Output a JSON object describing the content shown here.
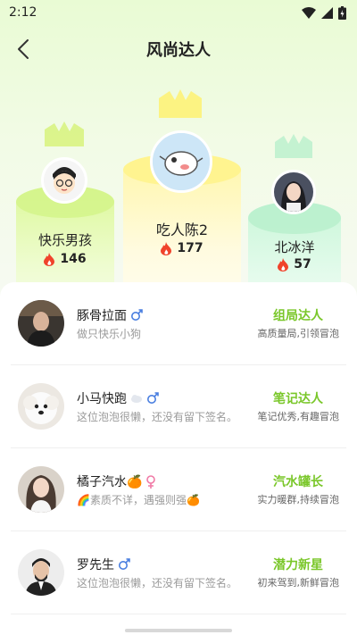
{
  "status_bar": {
    "time": "2:12"
  },
  "header": {
    "title": "风尚达人"
  },
  "podium": [
    {
      "rank": 1,
      "name": "吃人陈2",
      "score": "177"
    },
    {
      "rank": 2,
      "name": "快乐男孩",
      "score": "146"
    },
    {
      "rank": 3,
      "name": "北冰洋",
      "score": "57"
    }
  ],
  "list": [
    {
      "name": "豚骨拉面",
      "gender": "male",
      "signature": "做只快乐小狗",
      "badge": "组局达人",
      "badge_desc": "高质量局,引领冒泡"
    },
    {
      "name": "小马快跑",
      "gender": "male",
      "signature": "这位泡泡很懒，还没有留下签名。",
      "badge": "笔记达人",
      "badge_desc": "笔记优秀,有趣冒泡"
    },
    {
      "name": "橘子汽水🍊",
      "gender": "female",
      "signature": "🌈素质不详，遇强则强🍊",
      "badge": "汽水罐长",
      "badge_desc": "实力暖群,持续冒泡"
    },
    {
      "name": "罗先生",
      "gender": "male",
      "signature": "这位泡泡很懒，还没有留下签名。",
      "badge": "潜力新星",
      "badge_desc": "初来驾到,新鲜冒泡"
    }
  ],
  "colors": {
    "badge_green": "#7ac72a",
    "flame": "#f0432b",
    "male_icon": "#4a7fe0",
    "female_icon": "#f07aa6"
  },
  "icons": {
    "back": "chevron-left-icon",
    "score": "flame-icon",
    "crown": "crown-icon"
  }
}
